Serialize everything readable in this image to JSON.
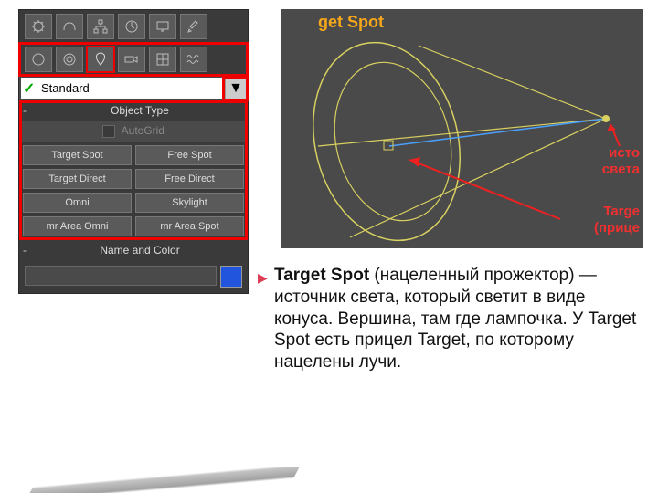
{
  "panel": {
    "dropdown_value": "Standard",
    "section_object_type": "Object Type",
    "autogrid_label": "AutoGrid",
    "types": {
      "r0c0": "Target Spot",
      "r0c1": "Free Spot",
      "r1c0": "Target Direct",
      "r1c1": "Free Direct",
      "r2c0": "Omni",
      "r2c1": "Skylight",
      "r3c0": "mr Area Omni",
      "r3c1": "mr Area Spot"
    },
    "section_name_color": "Name and Color",
    "color_swatch": "#2255dd"
  },
  "viewport": {
    "title": "get Spot",
    "annot_source": "исто",
    "annot_source2": "света",
    "annot_target1": "Targe",
    "annot_target2": "(прице"
  },
  "description": {
    "title": "Target Spot",
    "body_rest": " (нацеленный прожектор) — источник света,  который светит в виде конуса. Вершина, там где лампочка.   У  Target Spot есть прицел Target, по которому нацелены лучи."
  },
  "colors": {
    "highlight": "#e00000"
  }
}
